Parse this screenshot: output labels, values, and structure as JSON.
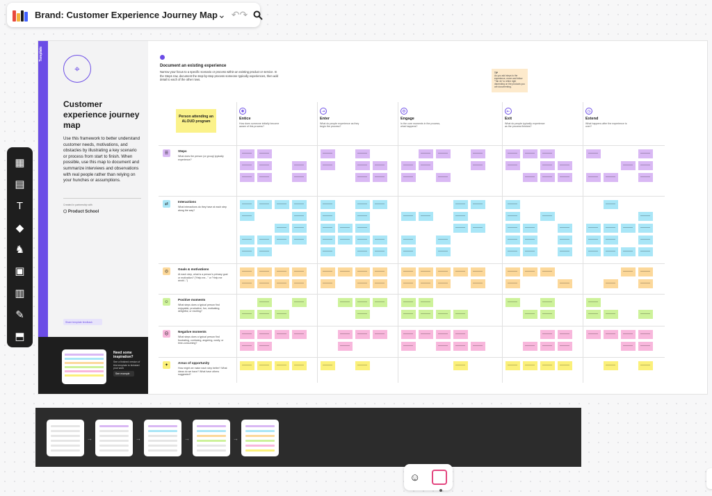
{
  "board": {
    "title": "Brand: Customer Experience Journey Map"
  },
  "colors": {
    "purple": "#d9b8f4",
    "cyan": "#a9e6f7",
    "orange": "#fcd89a",
    "green": "#cdf29a",
    "pink": "#f8b7dc",
    "yellow": "#fbf07a",
    "accent": "#6b4ce6",
    "logo": [
      "#e8493d",
      "#f3b23b",
      "#1e1e1e",
      "#4262ff"
    ]
  },
  "toolbar": {
    "icons": [
      "dropdown-chevron-icon",
      "undo-icon",
      "redo-icon",
      "search-icon"
    ]
  },
  "left_tools": [
    "templates-icon",
    "sticky-note-icon",
    "text-icon",
    "shapes-icon",
    "llama-icon",
    "image-icon",
    "table-icon",
    "pen-icon",
    "upload-icon"
  ],
  "side": {
    "tag": "Template",
    "title": "Customer experience journey map",
    "description": "Use this framework to better understand customer needs, motivations, and obstacles by illustrating a key scenario or process from start to finish. When possible, use this map to document and summarize interviews and observations with real people rather than relying on your hunches or assumptions.",
    "created_label": "Created in partnership with",
    "partner": "Product School",
    "share": "Share template feedback",
    "inspiration_title": "Need some inspiration?",
    "inspiration_desc": "See a finished version of this template to kickstart your work",
    "inspiration_btn": "See example"
  },
  "main": {
    "doc_title": "Document an existing experience",
    "doc_desc": "Narrow your focus to a specific scenario or process within an existing product or service. In the Steps row, document the step-by-step process someone typically experiences, then add detail to each of the other rows.",
    "tip_label": "TIP",
    "tip_text": "As you add steps to the experience, move and follow \"Tab 4s\" to refine right depending on the products you are documenting.",
    "persona": "Person attending an ALOUD program",
    "stages": [
      {
        "name": "Entice",
        "desc": "How does someone initially become aware of this process?"
      },
      {
        "name": "Enter",
        "desc": "What do people experience as they begin the process?"
      },
      {
        "name": "Engage",
        "desc": "In the core moments in the process, what happens?"
      },
      {
        "name": "Exit",
        "desc": "What do people typically experience as the process finishes?"
      },
      {
        "name": "Extend",
        "desc": "What happens after the experience is over?"
      }
    ],
    "rows": [
      {
        "name": "Steps",
        "desc": "What does the person (or group) typically experience?"
      },
      {
        "name": "Interactions",
        "desc": "What interactions do they have at each step along the way?"
      },
      {
        "name": "Goals & motivations",
        "desc": "At each step, what is a person's primary goal or motivation? (\"Help me...\" or \"Help me avoid...\")"
      },
      {
        "name": "Positive moments",
        "desc": "What steps does a typical person find enjoyable, productive, fun, motivating, delightful, or exciting?"
      },
      {
        "name": "Negative moments",
        "desc": "What steps does a typical person find frustrating, confusing, angering, costly, or time-consuming?"
      },
      {
        "name": "Areas of opportunity",
        "desc": "How might we make each step better? What ideas do we have? What have others suggested?"
      }
    ]
  }
}
